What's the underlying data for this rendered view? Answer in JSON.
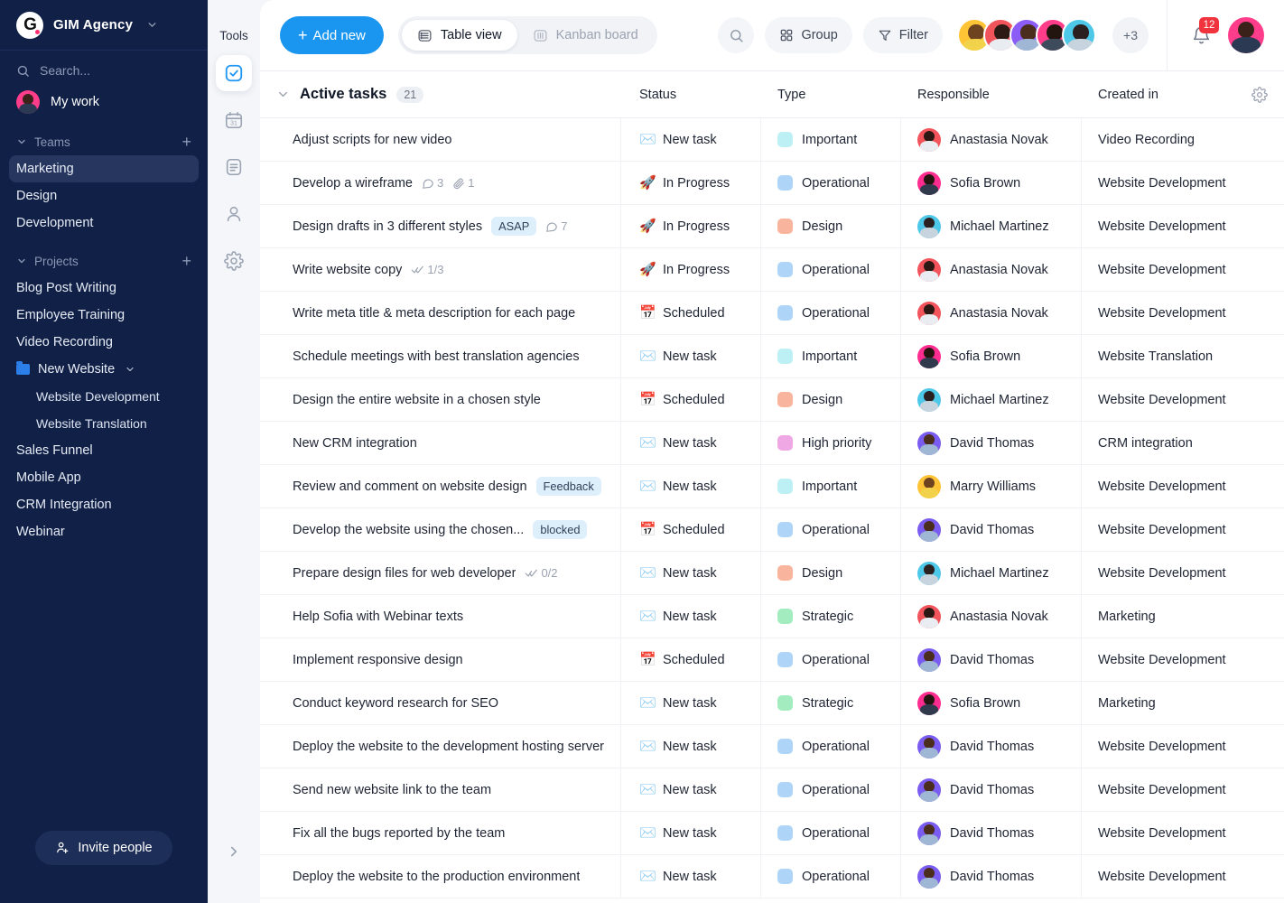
{
  "sidebar": {
    "brand": {
      "logo_text": "G",
      "name": "GIM Agency",
      "caret_icon": "chevron-down-icon"
    },
    "search_placeholder": "Search...",
    "my_work": "My work",
    "teams_label": "Teams",
    "teams": [
      "Marketing",
      "Design",
      "Development"
    ],
    "active_team": "Marketing",
    "projects_label": "Projects",
    "projects": [
      {
        "label": "Blog Post Writing",
        "type": "item"
      },
      {
        "label": "Employee Training",
        "type": "item"
      },
      {
        "label": "Video Recording",
        "type": "item"
      },
      {
        "label": "New Website",
        "type": "folder"
      },
      {
        "label": "Website Development",
        "type": "sub"
      },
      {
        "label": "Website Translation",
        "type": "sub"
      },
      {
        "label": "Sales Funnel",
        "type": "item"
      },
      {
        "label": "Mobile App",
        "type": "item"
      },
      {
        "label": "CRM Integration",
        "type": "item"
      },
      {
        "label": "Webinar",
        "type": "item"
      }
    ],
    "invite_label": "Invite people",
    "accent": "#1a96f0",
    "bg": "#102046"
  },
  "tools": {
    "title": "Tools",
    "items": [
      {
        "name": "tasks-check-icon",
        "active": true
      },
      {
        "name": "calendar-icon",
        "active": false
      },
      {
        "name": "document-icon",
        "active": false
      },
      {
        "name": "contacts-person-icon",
        "active": false
      },
      {
        "name": "settings-gear-icon",
        "active": false
      }
    ],
    "expand_icon": "chevron-right-icon"
  },
  "toolbar": {
    "add_new_label": "Add new",
    "views": [
      {
        "label": "Table view",
        "icon": "table-icon",
        "active": true
      },
      {
        "label": "Kanban board",
        "icon": "kanban-icon",
        "active": false
      }
    ],
    "search_icon": "search-icon",
    "group_label": "Group",
    "filter_label": "Filter",
    "overflow_members": "+3",
    "notification_count": "12",
    "members": [
      {
        "name": "member-1",
        "ring": "#ffc336",
        "hair": "#6d4320",
        "shirt": "#f2d24b"
      },
      {
        "name": "member-2",
        "ring": "#f2545b",
        "hair": "#2d1a14",
        "shirt": "#e9edf2"
      },
      {
        "name": "member-3",
        "ring": "#8b5cf6",
        "hair": "#4a2d1c",
        "shirt": "#9fb7d4"
      },
      {
        "name": "member-4",
        "ring": "#ff3d8b",
        "hair": "#221510",
        "shirt": "#3d4b5c"
      },
      {
        "name": "member-5",
        "ring": "#4ec8e8",
        "hair": "#2b2020",
        "shirt": "#c7d3dd"
      }
    ],
    "current_user": {
      "name": "current-user",
      "ring": "#ff3d8b",
      "hair": "#3a2119",
      "shirt": "#2b3a52"
    }
  },
  "group": {
    "title": "Active tasks",
    "count": "21",
    "collapse_icon": "chevron-down-icon",
    "settings_icon": "gear-icon"
  },
  "columns": {
    "task": "",
    "status": "Status",
    "type": "Type",
    "responsible": "Responsible",
    "created": "Created in"
  },
  "type_colors": {
    "Important": "#bdf0f5",
    "Operational": "#aed5f7",
    "Design": "#f8b49d",
    "High priority": "#efa8e4",
    "Strategic": "#a3ecbf"
  },
  "status_icons": {
    "New task": "✉️",
    "In Progress": "🚀",
    "Scheduled": "📅"
  },
  "people": {
    "Anastasia Novak": {
      "ring": "#f2545b",
      "hair": "#2b1812",
      "shirt": "#e9edf2"
    },
    "Sofia Brown": {
      "ring": "#ff2d8f",
      "hair": "#241410",
      "shirt": "#2f3b4c"
    },
    "Michael Martinez": {
      "ring": "#4ec8e8",
      "hair": "#2b2020",
      "shirt": "#c7d3dd"
    },
    "David Thomas": {
      "ring": "#7a5cf0",
      "hair": "#4a2d1c",
      "shirt": "#9fb7d4"
    },
    "Marry Williams": {
      "ring": "#ffc336",
      "hair": "#6d4320",
      "shirt": "#f2d24b"
    }
  },
  "rows": [
    {
      "task": "Adjust scripts for new video",
      "badge": null,
      "comments": null,
      "attachments": null,
      "subtasks": null,
      "status": "New task",
      "type": "Important",
      "responsible": "Anastasia Novak",
      "created": "Video Recording"
    },
    {
      "task": "Develop a wireframe",
      "badge": null,
      "comments": "3",
      "attachments": "1",
      "subtasks": null,
      "status": "In Progress",
      "type": "Operational",
      "responsible": "Sofia Brown",
      "created": "Website Development"
    },
    {
      "task": "Design drafts in 3 different styles",
      "badge": "ASAP",
      "comments": "7",
      "attachments": null,
      "subtasks": null,
      "status": "In Progress",
      "type": "Design",
      "responsible": "Michael Martinez",
      "created": "Website Development"
    },
    {
      "task": "Write website copy",
      "badge": null,
      "comments": null,
      "attachments": null,
      "subtasks": "1/3",
      "status": "In Progress",
      "type": "Operational",
      "responsible": "Anastasia Novak",
      "created": "Website Development"
    },
    {
      "task": "Write meta title & meta description for each page",
      "badge": null,
      "comments": null,
      "attachments": null,
      "subtasks": null,
      "status": "Scheduled",
      "type": "Operational",
      "responsible": "Anastasia Novak",
      "created": "Website Development"
    },
    {
      "task": "Schedule meetings with best translation agencies",
      "badge": null,
      "comments": null,
      "attachments": null,
      "subtasks": null,
      "status": "New task",
      "type": "Important",
      "responsible": "Sofia Brown",
      "created": "Website Translation"
    },
    {
      "task": "Design the entire website in a chosen style",
      "badge": null,
      "comments": null,
      "attachments": null,
      "subtasks": null,
      "status": "Scheduled",
      "type": "Design",
      "responsible": "Michael Martinez",
      "created": "Website Development"
    },
    {
      "task": "New CRM integration",
      "badge": null,
      "comments": null,
      "attachments": null,
      "subtasks": null,
      "status": "New task",
      "type": "High priority",
      "responsible": "David Thomas",
      "created": "CRM integration"
    },
    {
      "task": "Review and comment on website design",
      "badge": "Feedback",
      "comments": null,
      "attachments": null,
      "subtasks": null,
      "status": "New task",
      "type": "Important",
      "responsible": "Marry Williams",
      "created": "Website Development"
    },
    {
      "task": "Develop the website using the chosen...",
      "badge": "blocked",
      "comments": null,
      "attachments": null,
      "subtasks": null,
      "status": "Scheduled",
      "type": "Operational",
      "responsible": "David Thomas",
      "created": "Website Development"
    },
    {
      "task": "Prepare design files for web developer",
      "badge": null,
      "comments": null,
      "attachments": null,
      "subtasks": "0/2",
      "status": "New task",
      "type": "Design",
      "responsible": "Michael Martinez",
      "created": "Website Development"
    },
    {
      "task": "Help Sofia with Webinar texts",
      "badge": null,
      "comments": null,
      "attachments": null,
      "subtasks": null,
      "status": "New task",
      "type": "Strategic",
      "responsible": "Anastasia Novak",
      "created": "Marketing"
    },
    {
      "task": "Implement responsive design",
      "badge": null,
      "comments": null,
      "attachments": null,
      "subtasks": null,
      "status": "Scheduled",
      "type": "Operational",
      "responsible": "David Thomas",
      "created": "Website Development"
    },
    {
      "task": "Conduct keyword research for SEO",
      "badge": null,
      "comments": null,
      "attachments": null,
      "subtasks": null,
      "status": "New task",
      "type": "Strategic",
      "responsible": "Sofia Brown",
      "created": "Marketing"
    },
    {
      "task": "Deploy the website to the development hosting server",
      "badge": null,
      "comments": null,
      "attachments": null,
      "subtasks": null,
      "status": "New task",
      "type": "Operational",
      "responsible": "David Thomas",
      "created": "Website Development"
    },
    {
      "task": "Send new website link to the team",
      "badge": null,
      "comments": null,
      "attachments": null,
      "subtasks": null,
      "status": "New task",
      "type": "Operational",
      "responsible": "David Thomas",
      "created": "Website Development"
    },
    {
      "task": "Fix all the bugs reported by the team",
      "badge": null,
      "comments": null,
      "attachments": null,
      "subtasks": null,
      "status": "New task",
      "type": "Operational",
      "responsible": "David Thomas",
      "created": "Website Development"
    },
    {
      "task": "Deploy the website to the production environment",
      "badge": null,
      "comments": null,
      "attachments": null,
      "subtasks": null,
      "status": "New task",
      "type": "Operational",
      "responsible": "David Thomas",
      "created": "Website Development"
    }
  ]
}
